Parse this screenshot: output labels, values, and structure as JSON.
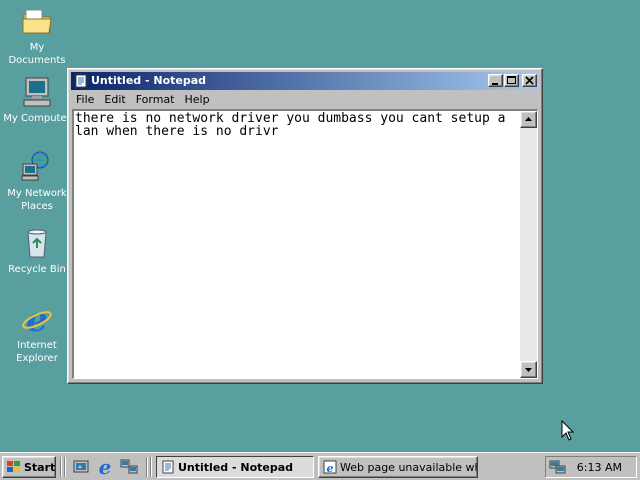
{
  "desktop": {
    "icons": [
      {
        "label": "My Documents"
      },
      {
        "label": "My Computer"
      },
      {
        "label": "My Network Places"
      },
      {
        "label": "Recycle Bin"
      },
      {
        "label": "Internet Explorer"
      }
    ]
  },
  "window": {
    "title": "Untitled - Notepad",
    "menu": [
      "File",
      "Edit",
      "Format",
      "Help"
    ],
    "content": "there is no network driver you dumbass you cant setup a lan when there is no drivr"
  },
  "taskbar": {
    "start_label": "Start",
    "tasks": [
      {
        "label": "Untitled - Notepad",
        "active": true
      },
      {
        "label": "Web page unavailable wh...",
        "active": false
      }
    ],
    "clock": "6:13 AM"
  },
  "colors": {
    "desktop": "#5a9fa0",
    "titlebar_start": "#0a246a",
    "titlebar_end": "#a6caf0"
  }
}
